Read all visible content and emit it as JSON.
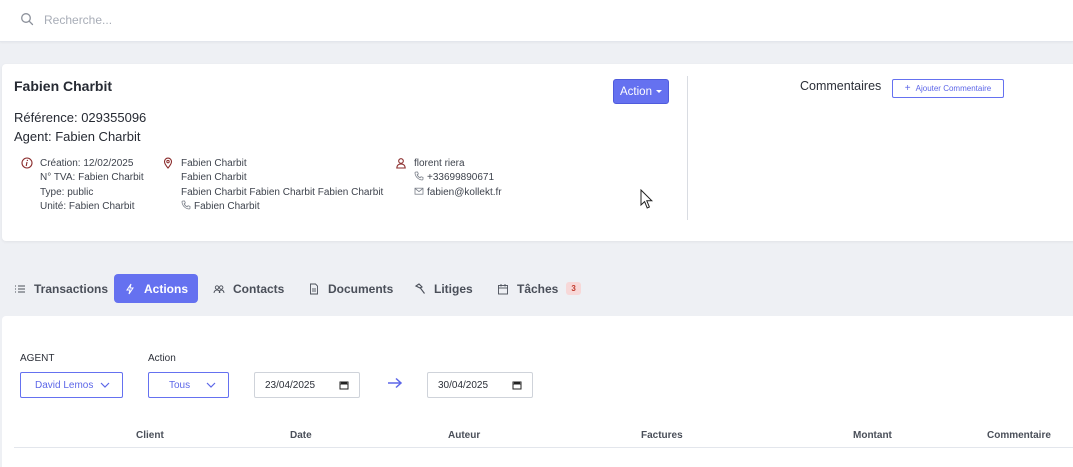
{
  "search": {
    "placeholder": "Recherche..."
  },
  "client": {
    "name": "Fabien Charbit",
    "reference": "Référence: 029355096",
    "agent": "Agent: Fabien Charbit",
    "details": {
      "creation": "Création: 12/02/2025",
      "tva": "N° TVA: Fabien Charbit",
      "type": "Type: public",
      "unite": "Unité: Fabien Charbit"
    },
    "address": {
      "line1": "Fabien Charbit",
      "line2": "Fabien Charbit",
      "line3": "Fabien Charbit Fabien Charbit Fabien Charbit",
      "phone": "Fabien Charbit"
    },
    "contact": {
      "name": "florent riera",
      "phone": "+33699890671",
      "email": "fabien@kollekt.fr"
    },
    "action_label": "Action"
  },
  "comments": {
    "title": "Commentaires",
    "add_label": "Ajouter Commentaire"
  },
  "tabs": [
    {
      "label": "Transactions",
      "icon": "list-icon",
      "active": false
    },
    {
      "label": "Actions",
      "icon": "bolt-icon",
      "active": true
    },
    {
      "label": "Contacts",
      "icon": "users-icon",
      "active": false
    },
    {
      "label": "Documents",
      "icon": "document-icon",
      "active": false
    },
    {
      "label": "Litiges",
      "icon": "hammer-icon",
      "active": false
    },
    {
      "label": "Tâches",
      "icon": "calendar-icon",
      "active": false,
      "badge": "3"
    }
  ],
  "filters": {
    "agent_label": "AGENT",
    "agent_value": "David Lemos",
    "action_label": "Action",
    "action_value": "Tous",
    "date_from": "23/04/2025",
    "date_to": "30/04/2025"
  },
  "table": {
    "headers": [
      "Client",
      "Date",
      "Auteur",
      "Factures",
      "Montant",
      "Commentaire"
    ]
  },
  "colors": {
    "accent": "#6571f0",
    "badge_bg": "#f7d8d8",
    "badge_text": "#c0392b"
  }
}
